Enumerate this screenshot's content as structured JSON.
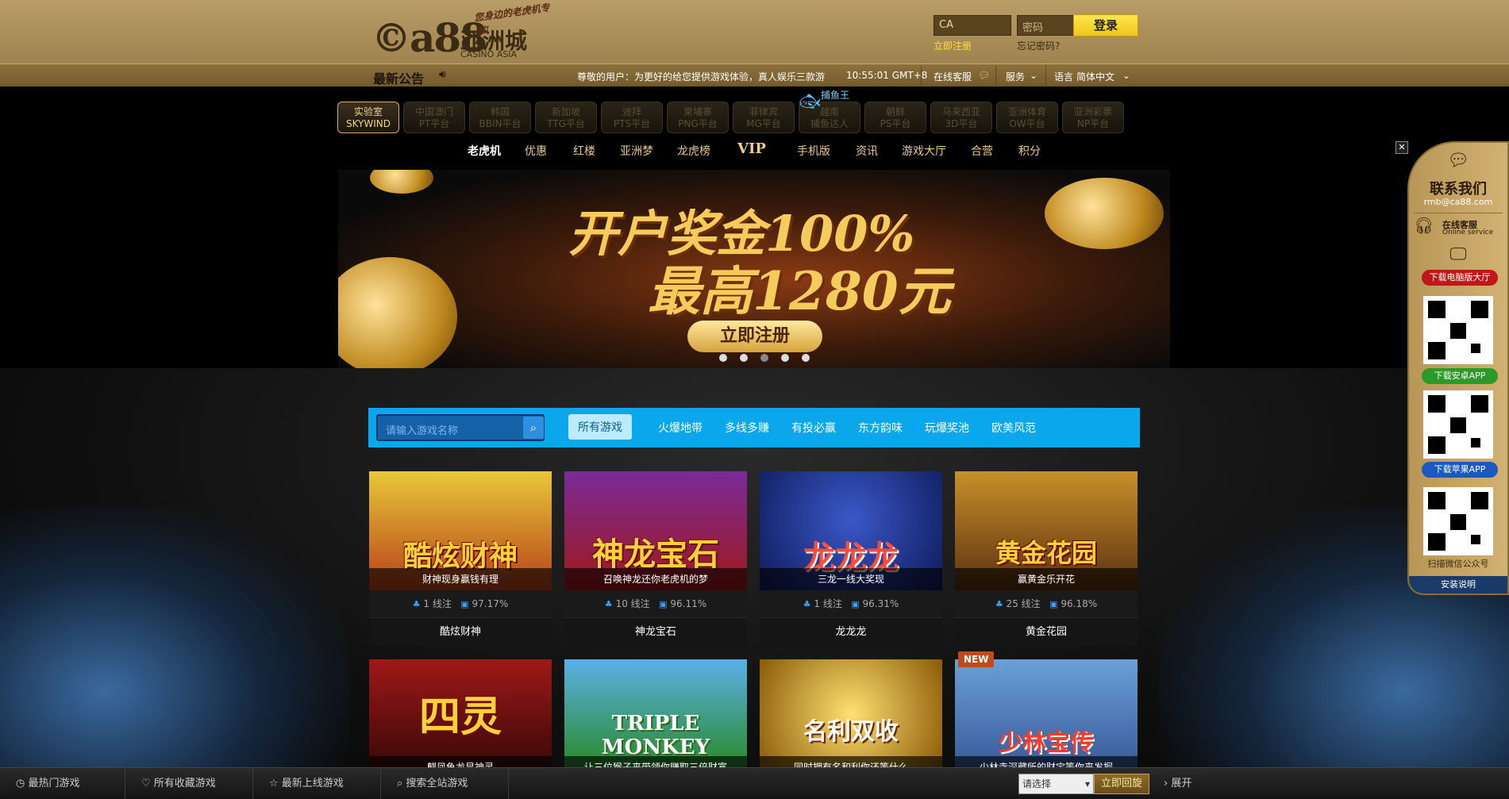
{
  "header": {
    "logo_mark": "©a88",
    "logo_cn": "亚洲城",
    "logo_en": "CASINO ASIA",
    "logo_tagline": "您身边的老虎机专家!",
    "username_value": "CA",
    "password_placeholder": "密码",
    "login_label": "登录",
    "register_label": "立即注册",
    "forgot_label": "忘记密码?"
  },
  "announce": {
    "label": "最新公告",
    "marquee": "尊敬的用户：为更好的给您提供游戏体验，真人娱乐三款游",
    "time": "10:55:01 GMT+8",
    "online_service": "在线客服",
    "service": "服务",
    "language_label": "语言",
    "language": "简体中文"
  },
  "game_categories": [
    {
      "cn": "实验室",
      "en": "SKYWIND"
    },
    {
      "cn": "中国澳门",
      "en": "PT平台"
    },
    {
      "cn": "韩国",
      "en": "BBIN平台"
    },
    {
      "cn": "新加坡",
      "en": "TTG平台"
    },
    {
      "cn": "迪拜",
      "en": "PTS平台"
    },
    {
      "cn": "柬埔寨",
      "en": "PNG平台"
    },
    {
      "cn": "菲律宾",
      "en": "MG平台"
    },
    {
      "cn": "越南",
      "en": "捕鱼达人"
    },
    {
      "cn": "朝鲜",
      "en": "PS平台"
    },
    {
      "cn": "马来西亚",
      "en": "3D平台"
    },
    {
      "cn": "亚洲体育",
      "en": "OW平台"
    },
    {
      "cn": "亚洲彩票",
      "en": "NP平台"
    }
  ],
  "fishing_label": "捕鱼王",
  "main_nav": [
    "老虎机",
    "优惠",
    "红楼",
    "亚洲梦",
    "龙虎榜",
    "VIP",
    "手机版",
    "资讯",
    "游戏大厅",
    "合营",
    "积分"
  ],
  "banner": {
    "line1": "开户奖金100%",
    "line2": "最高1280元",
    "cta": "立即注册"
  },
  "filter": {
    "search_placeholder": "请输入游戏名称",
    "tabs": [
      "所有游戏",
      "火爆地带",
      "多线多赚",
      "有投必赢",
      "东方韵味",
      "玩爆奖池",
      "欧美风范"
    ]
  },
  "games": [
    {
      "name": "酷炫财神",
      "title_art": "酷炫财神",
      "caption": "财神现身赢钱有理",
      "lines": "1 线注",
      "rtp": "97.17%",
      "badge": ""
    },
    {
      "name": "神龙宝石",
      "title_art": "神龙宝石",
      "caption": "召唤神龙还你老虎机的梦",
      "lines": "10 线注",
      "rtp": "96.11%",
      "badge": ""
    },
    {
      "name": "龙龙龙",
      "title_art": "龙龙龙",
      "caption": "三龙一线大奖现",
      "lines": "1 线注",
      "rtp": "96.31%",
      "badge": ""
    },
    {
      "name": "黄金花园",
      "title_art": "黄金花园",
      "caption": "赢黄金乐开花",
      "lines": "25 线注",
      "rtp": "96.18%",
      "badge": ""
    },
    {
      "name": "",
      "title_art": "四灵",
      "caption": "麒凤龟龙显神灵",
      "lines": "",
      "rtp": "",
      "badge": ""
    },
    {
      "name": "",
      "title_art": "TRIPLE MONKEY",
      "caption": "让三位猴子来带领你赚取三倍财富",
      "lines": "",
      "rtp": "",
      "badge": ""
    },
    {
      "name": "",
      "title_art": "名利双收",
      "caption": "同时拥有名和利你还等什么",
      "lines": "",
      "rtp": "",
      "badge": ""
    },
    {
      "name": "",
      "title_art": "少林宝传",
      "caption": "少林寺深藏所的财宝等你来发掘",
      "lines": "",
      "rtp": "",
      "badge": "NEW"
    }
  ],
  "sidebar": {
    "contact": "联系我们",
    "email": "rmb@ca88.com",
    "online_cn": "在线客服",
    "online_en": "Online service",
    "download_pc": "下载电脑版大厅",
    "download_android": "下载安卓APP",
    "download_ios": "下载苹果APP",
    "wechat": "扫描微信公众号",
    "install_help": "安装说明",
    "close": "✕"
  },
  "bottom": {
    "hot": "最热门游戏",
    "fav": "所有收藏游戏",
    "newest": "最新上线游戏",
    "search": "搜索全站游戏",
    "select": "请选择",
    "back": "立即回旋",
    "expand": "展开"
  }
}
